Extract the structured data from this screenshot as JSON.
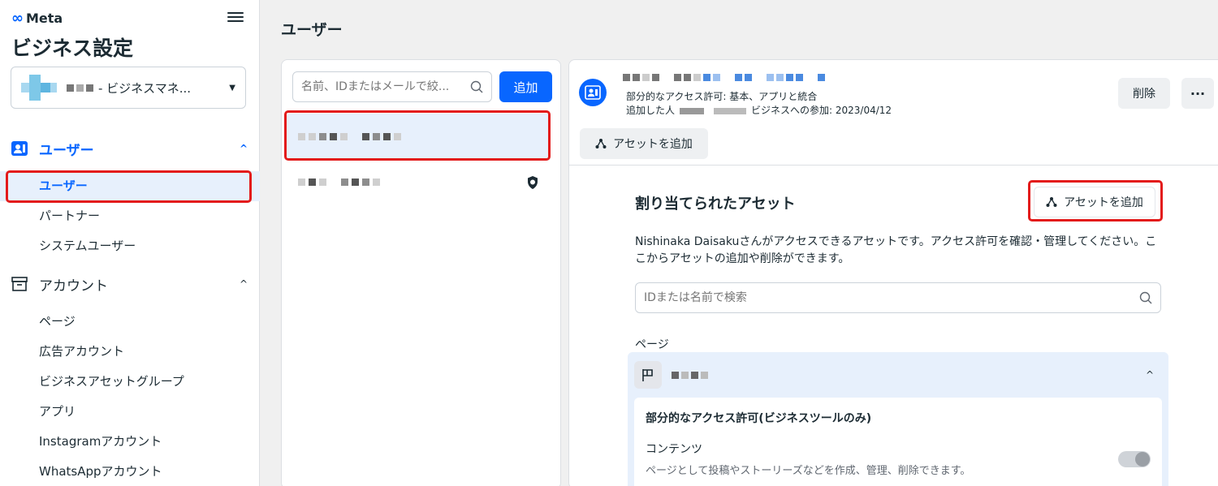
{
  "brand": {
    "logo_text": "Meta"
  },
  "sidebar": {
    "app_title": "ビジネス設定",
    "business_selector": {
      "name": "- ビジネスマネ...",
      "caret": "▼"
    },
    "sections": [
      {
        "label": "ユーザー",
        "chevron": "^",
        "items": [
          {
            "label": "ユーザー"
          },
          {
            "label": "パートナー"
          },
          {
            "label": "システムユーザー"
          }
        ]
      },
      {
        "label": "アカウント",
        "chevron": "^",
        "items": [
          {
            "label": "ページ"
          },
          {
            "label": "広告アカウント"
          },
          {
            "label": "ビジネスアセットグループ"
          },
          {
            "label": "アプリ"
          },
          {
            "label": "Instagramアカウント"
          },
          {
            "label": "WhatsAppアカウント"
          }
        ]
      }
    ]
  },
  "header": {
    "title": "ユーザー"
  },
  "users_panel": {
    "search_placeholder": "名前、IDまたはメールで絞...",
    "add_button": "追加"
  },
  "detail": {
    "access_line": "部分的なアクセス許可: 基本、アプリと統合",
    "added_by_label": "追加した人",
    "joined_label": "ビジネスへの参加: 2023/04/12",
    "add_asset_button": "アセットを追加",
    "delete_button": "削除",
    "more_button": "···",
    "assigned_title": "割り当てられたアセット",
    "add_asset_button_2": "アセットを追加",
    "description": "Nishinaka Daisakuさんがアクセスできるアセットです。アクセス許可を確認・管理してください。ここからアセットの追加や削除ができます。",
    "asset_search_placeholder": "IDまたは名前で検索",
    "section_label": "ページ",
    "card_chevron": "^",
    "permission_title": "部分的なアクセス許可(ビジネスツールのみ)",
    "permission_item": "コンテンツ",
    "permission_desc": "ページとして投稿やストーリーズなどを作成、管理、削除できます。",
    "content_toggle_on": true
  },
  "colors": {
    "accent": "#0866ff",
    "highlight": "#e31b1b",
    "selected_bg": "#e7f0fc"
  }
}
